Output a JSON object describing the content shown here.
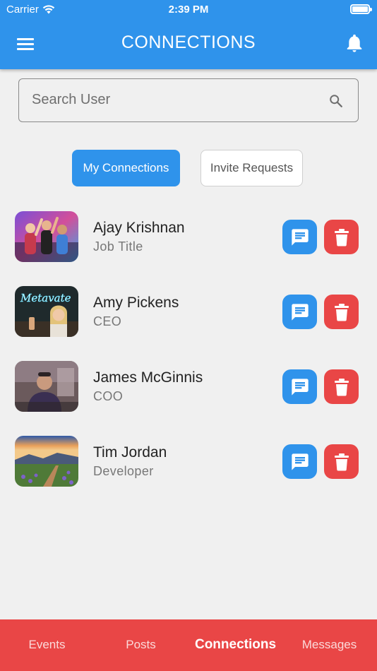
{
  "status_bar": {
    "carrier": "Carrier",
    "time": "2:39 PM"
  },
  "header": {
    "title": "CONNECTIONS"
  },
  "search": {
    "placeholder": "Search User"
  },
  "segments": {
    "active": "My Connections",
    "inactive": "Invite Requests"
  },
  "connections": [
    {
      "name": "Ajay Krishnan",
      "title": "Job Title"
    },
    {
      "name": "Amy Pickens",
      "title": "CEO"
    },
    {
      "name": "James McGinnis",
      "title": "COO"
    },
    {
      "name": "Tim Jordan",
      "title": "Developer"
    }
  ],
  "avatar_overlay": {
    "neon_sign": "Metavate"
  },
  "tabs": [
    "Events",
    "Posts",
    "Connections",
    "Messages"
  ],
  "colors": {
    "primary": "#2f93eb",
    "danger": "#e94646",
    "background": "#f0f0f0"
  },
  "icons": {
    "menu": "menu-icon",
    "bell": "bell-icon",
    "search": "search-icon",
    "message": "chat-icon",
    "delete": "trash-icon",
    "wifi": "wifi-icon",
    "battery": "battery-icon"
  }
}
